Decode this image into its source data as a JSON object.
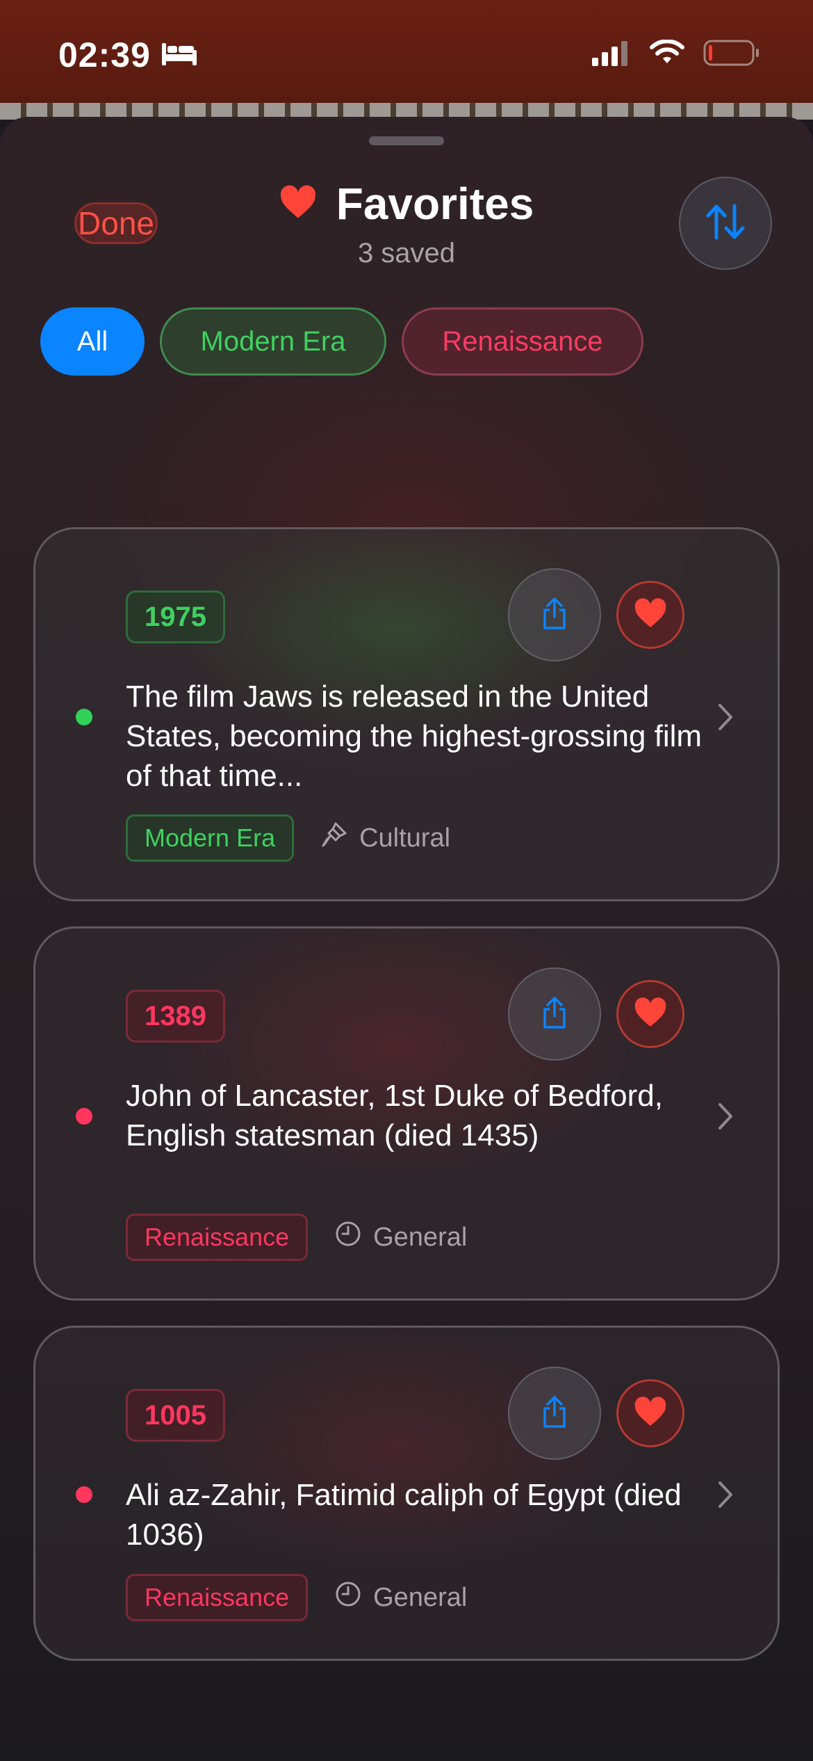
{
  "status_bar": {
    "time": "02:39"
  },
  "header": {
    "done_label": "Done",
    "title": "Favorites",
    "subtitle": "3 saved"
  },
  "filters": [
    {
      "label": "All",
      "selected": true
    },
    {
      "label": "Modern Era",
      "selected": false
    },
    {
      "label": "Renaissance",
      "selected": false
    }
  ],
  "cards": [
    {
      "year": "1975",
      "text": "The film Jaws is released in the United States, becoming the highest-grossing film of that time...",
      "era": "Modern Era",
      "category": "Cultural",
      "category_icon": "paintbrush-icon"
    },
    {
      "year": "1389",
      "text": "John of Lancaster, 1st Duke of Bedford, English statesman (died 1435)",
      "era": "Renaissance",
      "category": "General",
      "category_icon": "clock-icon"
    },
    {
      "year": "1005",
      "text": "Ali az-Zahir, Fatimid caliph of Egypt (died 1036)",
      "era": "Renaissance",
      "category": "General",
      "category_icon": "clock-icon"
    }
  ],
  "colors": {
    "accent_blue": "#0a84ff",
    "modern_green": "#3fd160",
    "renaissance_red": "#ff375f",
    "heart_red": "#ff453a"
  }
}
